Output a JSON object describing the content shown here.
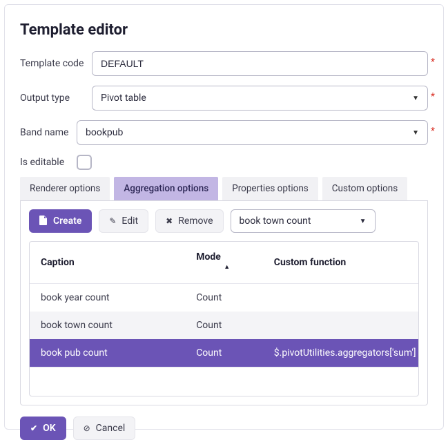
{
  "title": "Template editor",
  "fields": {
    "template_code": {
      "label": "Template code",
      "value": "DEFAULT"
    },
    "output_type": {
      "label": "Output type",
      "value": "Pivot table"
    },
    "band_name": {
      "label": "Band name",
      "value": "bookpub"
    },
    "is_editable": {
      "label": "Is editable"
    }
  },
  "tabs": {
    "renderer": "Renderer options",
    "aggregation": "Aggregation options",
    "properties": "Properties options",
    "custom": "Custom options"
  },
  "toolbar": {
    "create": "Create",
    "edit": "Edit",
    "remove": "Remove",
    "select_value": "book town count"
  },
  "table": {
    "headers": {
      "caption": "Caption",
      "mode": "Mode",
      "func": "Custom function"
    },
    "rows": [
      {
        "caption": "book year count",
        "mode": "Count",
        "func": ""
      },
      {
        "caption": "book town count",
        "mode": "Count",
        "func": ""
      },
      {
        "caption": "book pub count",
        "mode": "Count",
        "func": "$.pivotUtilities.aggregators['sum']"
      }
    ]
  },
  "footer": {
    "ok": "OK",
    "cancel": "Cancel"
  }
}
